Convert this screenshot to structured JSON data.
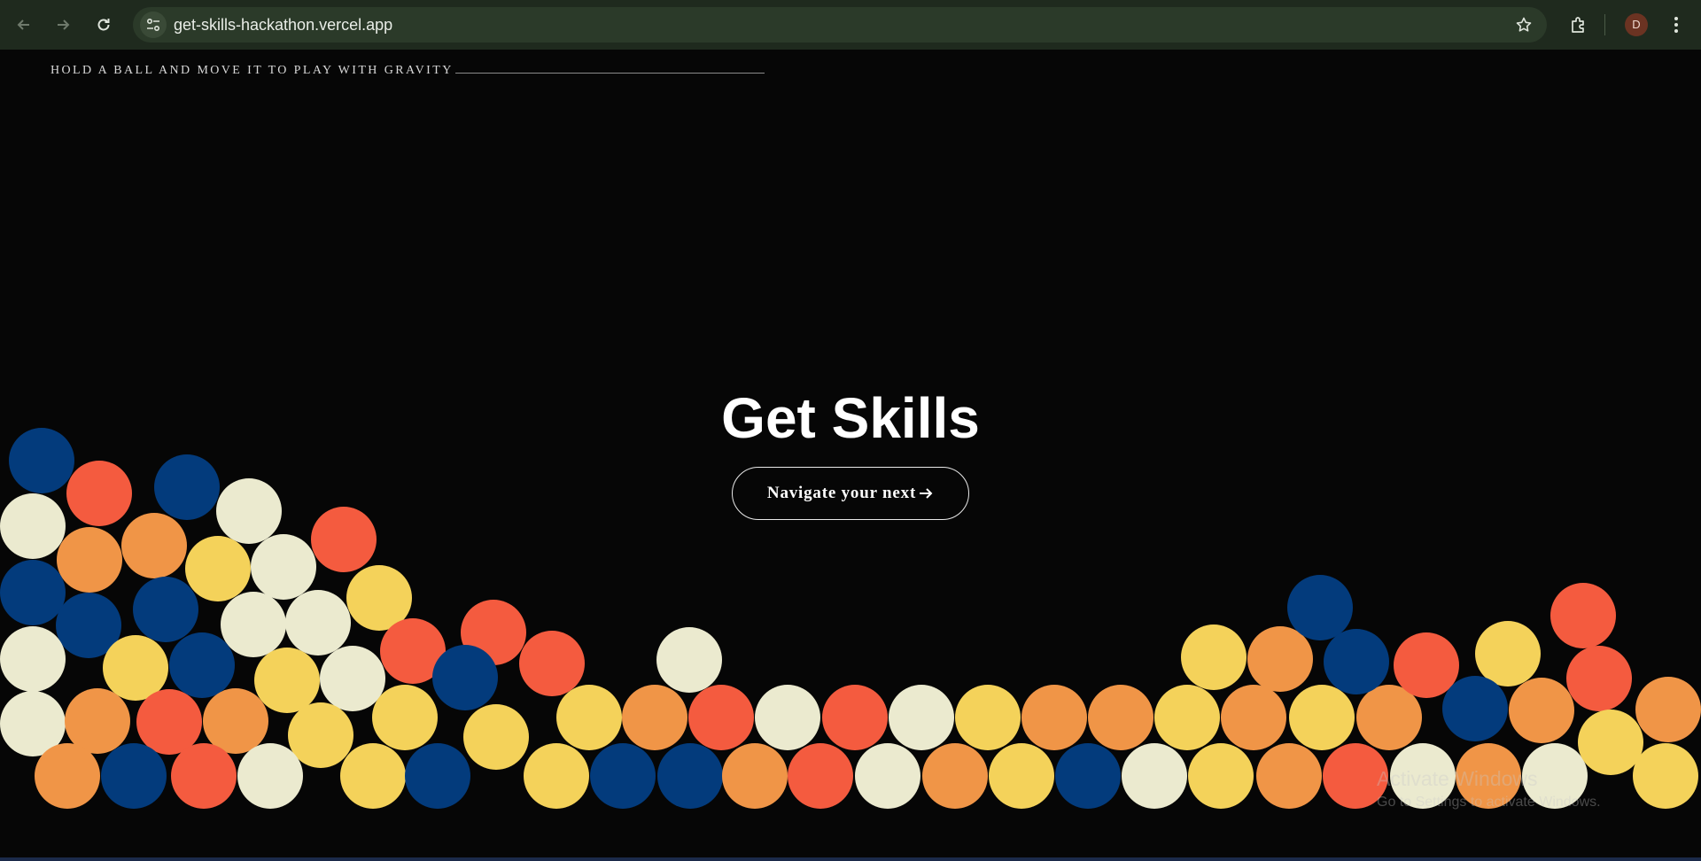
{
  "browser": {
    "url": "get-skills-hackathon.vercel.app",
    "profile_initial": "D",
    "icons": {
      "back": "arrow-left-icon",
      "forward": "arrow-right-icon",
      "reload": "reload-icon",
      "site_info": "tune-icon",
      "bookmark": "star-icon",
      "extensions": "puzzle-icon",
      "menu": "kebab-menu-icon"
    }
  },
  "page": {
    "hint": "HOLD A BALL AND MOVE IT TO PLAY WITH GRAVITY",
    "title": "Get Skills",
    "cta_label": "Navigate your next",
    "cta_icon": "arrow-right-icon",
    "colors": {
      "background": "#060606",
      "navy": "#033b7c",
      "red": "#f45b3f",
      "orange": "#f09547",
      "yellow": "#f4d25a",
      "cream": "#ebeacf"
    }
  },
  "watermark": {
    "title": "Activate Windows",
    "subtitle": "Go to Settings to activate Windows."
  }
}
